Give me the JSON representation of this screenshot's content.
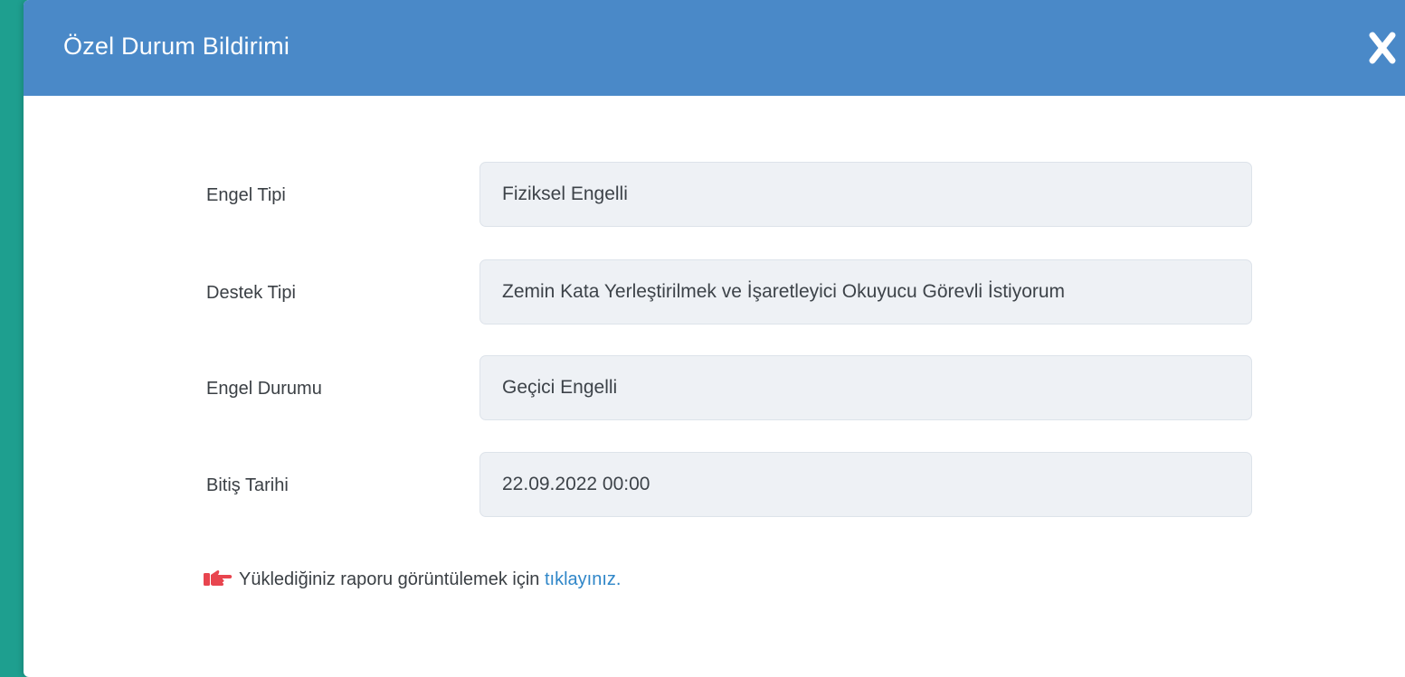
{
  "modal": {
    "title": "Özel Durum Bildirimi",
    "close_icon": "close-icon"
  },
  "fields": [
    {
      "label": "Engel Tipi",
      "value": "Fiziksel Engelli"
    },
    {
      "label": "Destek Tipi",
      "value": "Zemin Kata Yerleştirilmek ve İşaretleyici Okuyucu Görevli İstiyorum"
    },
    {
      "label": "Engel Durumu",
      "value": "Geçici Engelli"
    },
    {
      "label": "Bitiş Tarihi",
      "value": "22.09.2022 00:00"
    }
  ],
  "note": {
    "icon": "pointing-hand-icon",
    "text": "Yüklediğiniz raporu görüntülemek için ",
    "link": "tıklayınız."
  },
  "colors": {
    "header": "#4a89c8",
    "backdrop": "#1e9f8f",
    "field_bg": "#eef1f5",
    "link": "#2f86c8",
    "hand_icon": "#e8454f"
  }
}
